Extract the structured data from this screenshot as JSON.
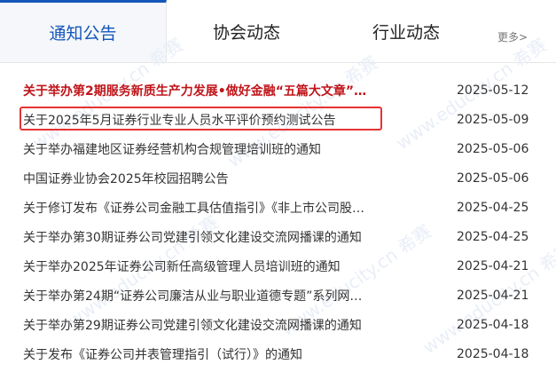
{
  "tabs": {
    "notices": "通知公告",
    "association": "协会动态",
    "industry": "行业动态",
    "more": "更多>"
  },
  "watermark": "www.educity.cn 希赛",
  "notices": [
    {
      "title": "关于举办第2期服务新质生产力发展•做好金融“五篇大文章”…",
      "date": "2025-05-12",
      "bold": true
    },
    {
      "title": "关于2025年5月证券行业专业人员水平评价预约测试公告",
      "date": "2025-05-09",
      "highlighted": true
    },
    {
      "title": "关于举办福建地区证券经营机构合规管理培训班的通知",
      "date": "2025-05-06"
    },
    {
      "title": "中国证券业协会2025年校园招聘公告",
      "date": "2025-05-06"
    },
    {
      "title": "关于修订发布《证券公司金融工具估值指引》《非上市公司股…",
      "date": "2025-04-25"
    },
    {
      "title": "关于举办第30期证券公司党建引领文化建设交流网播课的通知",
      "date": "2025-04-25"
    },
    {
      "title": "关于举办2025年证券公司新任高级管理人员培训班的通知",
      "date": "2025-04-21"
    },
    {
      "title": "关于举办第24期“证券公司廉洁从业与职业道德专题”系列网…",
      "date": "2025-04-21"
    },
    {
      "title": "关于举办第29期证券公司党建引领文化建设交流网播课的通知",
      "date": "2025-04-18"
    },
    {
      "title": "关于发布《证券公司并表管理指引（试行）》的通知",
      "date": "2025-04-18"
    }
  ]
}
